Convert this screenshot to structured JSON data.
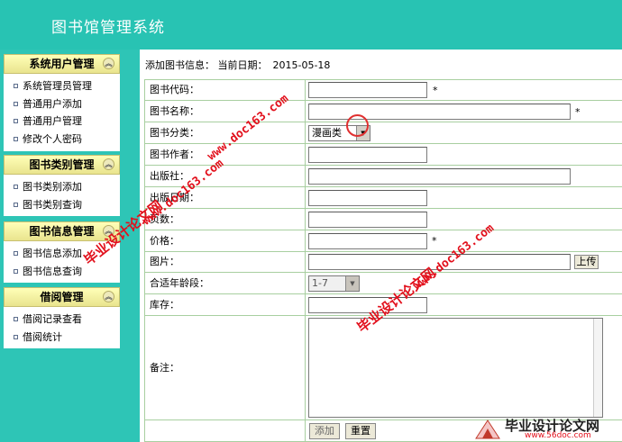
{
  "app": {
    "title": "图书馆管理系统"
  },
  "sidebar": {
    "sections": [
      {
        "title": "系统用户管理",
        "items": [
          "系统管理员管理",
          "普通用户添加",
          "普通用户管理",
          "修改个人密码"
        ]
      },
      {
        "title": "图书类别管理",
        "items": [
          "图书类别添加",
          "图书类别查询"
        ]
      },
      {
        "title": "图书信息管理",
        "items": [
          "图书信息添加",
          "图书信息查询"
        ]
      },
      {
        "title": "借阅管理",
        "items": [
          "借阅记录查看",
          "借阅统计"
        ]
      }
    ]
  },
  "main": {
    "heading": "添加图书信息： 当前日期：",
    "date": "2015-05-18",
    "form": {
      "book_code": {
        "label": "图书代码：",
        "value": "",
        "required": "*"
      },
      "book_name": {
        "label": "图书名称：",
        "value": "",
        "required": "*"
      },
      "category": {
        "label": "图书分类：",
        "selected": "漫画类"
      },
      "author": {
        "label": "图书作者：",
        "value": ""
      },
      "publisher": {
        "label": "出版社：",
        "value": ""
      },
      "publish_date": {
        "label": "出版日期：",
        "value": ""
      },
      "pages": {
        "label": "页数：",
        "value": ""
      },
      "price": {
        "label": "价格：",
        "value": "",
        "required": "*"
      },
      "image": {
        "label": "图片：",
        "value": "",
        "upload_label": "上传"
      },
      "age_group": {
        "label": "合适年龄段：",
        "selected": "1-7"
      },
      "stock": {
        "label": "库存：",
        "value": ""
      },
      "remarks": {
        "label": "备注：",
        "value": ""
      },
      "submit_label": "添加",
      "reset_label": "重置"
    }
  },
  "watermarks": {
    "w1": "毕业设计论文网",
    "w2": "www.doc163.com",
    "w3": "毕业设计论文网",
    "w4": "www.doc163.com",
    "w5": "毕业设计论文网",
    "w6": "www.doc163.com",
    "logo_text": "毕业设计论文网",
    "logo_url": "www.56doc.com"
  }
}
